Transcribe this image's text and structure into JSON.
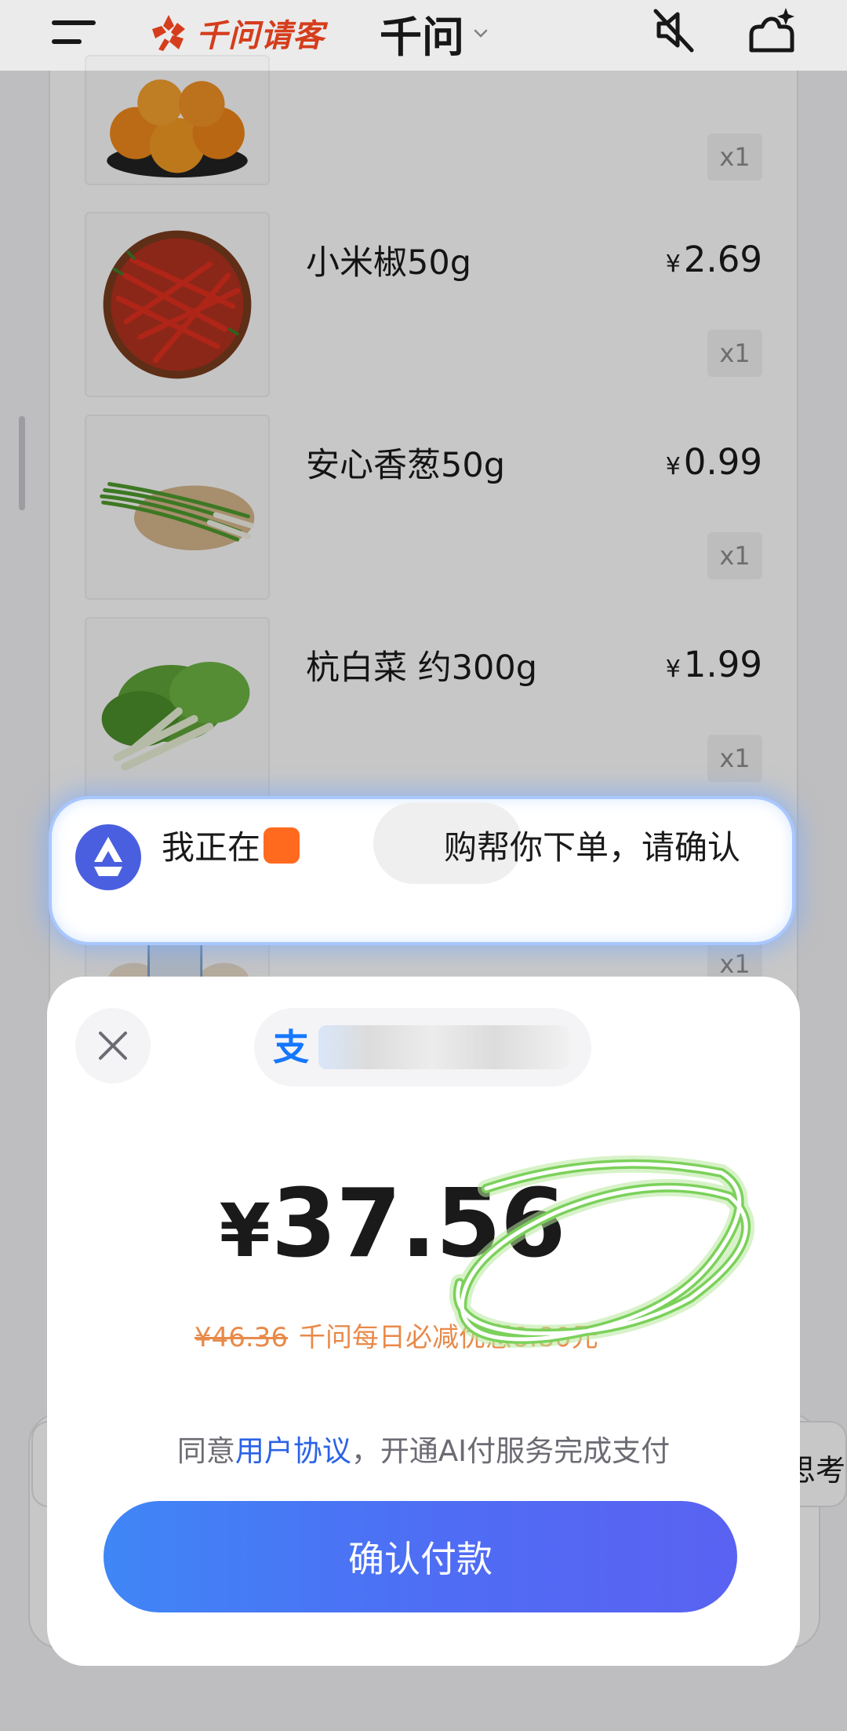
{
  "header": {
    "brand_name": "千问请客",
    "app_title": "千问",
    "icons": [
      "menu-icon",
      "brand-logo-icon",
      "chevron-down-icon",
      "mute-icon",
      "new-chat-icon"
    ]
  },
  "order_items": [
    {
      "name": "",
      "price": "",
      "quantity": "x1",
      "image": "oranges"
    },
    {
      "name": "小米椒50g",
      "price": "2.69",
      "currency": "¥",
      "quantity": "x1",
      "image": "red-chilies"
    },
    {
      "name": "安心香葱50g",
      "price": "0.99",
      "currency": "¥",
      "quantity": "x1",
      "image": "scallions"
    },
    {
      "name": "杭白菜 约300g",
      "price": "1.99",
      "currency": "¥",
      "quantity": "x1",
      "image": "bok-choy"
    },
    {
      "name": "",
      "price": "",
      "quantity": "x1",
      "image": "partially-hidden"
    }
  ],
  "agent_banner": {
    "text_before": "我正在",
    "text_after": "购帮你下单，请确认"
  },
  "payment": {
    "currency": "¥",
    "amount": "37.56",
    "original_price": "¥46.36",
    "discount_text": "千问每日必减优惠8.80元",
    "agreement_prefix": "同意",
    "agreement_link": "用户协议",
    "agreement_suffix": "，开通AI付服务完成支付",
    "confirm_label": "确认付款"
  },
  "background_peek": {
    "thinking_label": "思考"
  },
  "colors": {
    "brand": "#e8431f",
    "accent": "#4f6cf4",
    "discount": "#e88a4a",
    "link": "#2b63e6",
    "annotation": "#7bd15a"
  }
}
